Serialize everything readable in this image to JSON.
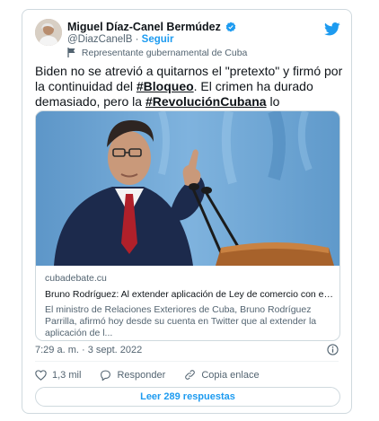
{
  "author": {
    "name": "Miguel Díaz-Canel Bermúdez",
    "handle": "@DiazCanelB",
    "follow_label": "Seguir",
    "separator": "·",
    "label": "Representante gubernamental de Cuba"
  },
  "tweet": {
    "text_1": "Biden no se atrevió a quitarnos el \"pretexto\" y firmó por la continuidad del ",
    "hashtag_1": "#Bloqueo",
    "text_2": ". El  crimen ha durado demasiado, pero la ",
    "hashtag_2": "#RevoluciónCubana",
    "text_3": "  lo sobrevivirá."
  },
  "link_card": {
    "domain": "cubadebate.cu",
    "headline": "Bruno Rodríguez: Al extender aplicación de Ley de comercio con el ene...",
    "description": "El ministro de Relaciones Exteriores de Cuba, Bruno Rodríguez Parrilla, afirmó hoy desde su cuenta en Twitter que al extender la aplicación de l..."
  },
  "timestamp": "7:29 a. m. · 3 sept. 2022",
  "actions": {
    "likes": "1,3 mil",
    "reply": "Responder",
    "copy_link": "Copia enlace"
  },
  "read_replies": "Leer 289 respuestas",
  "colors": {
    "accent": "#1d9bf0",
    "secondary_text": "#536471",
    "border": "#cfd9de"
  },
  "icons": [
    "avatar",
    "verified-badge-icon",
    "twitter-bird-icon",
    "flag-icon",
    "info-icon",
    "heart-icon",
    "reply-icon",
    "link-icon"
  ]
}
